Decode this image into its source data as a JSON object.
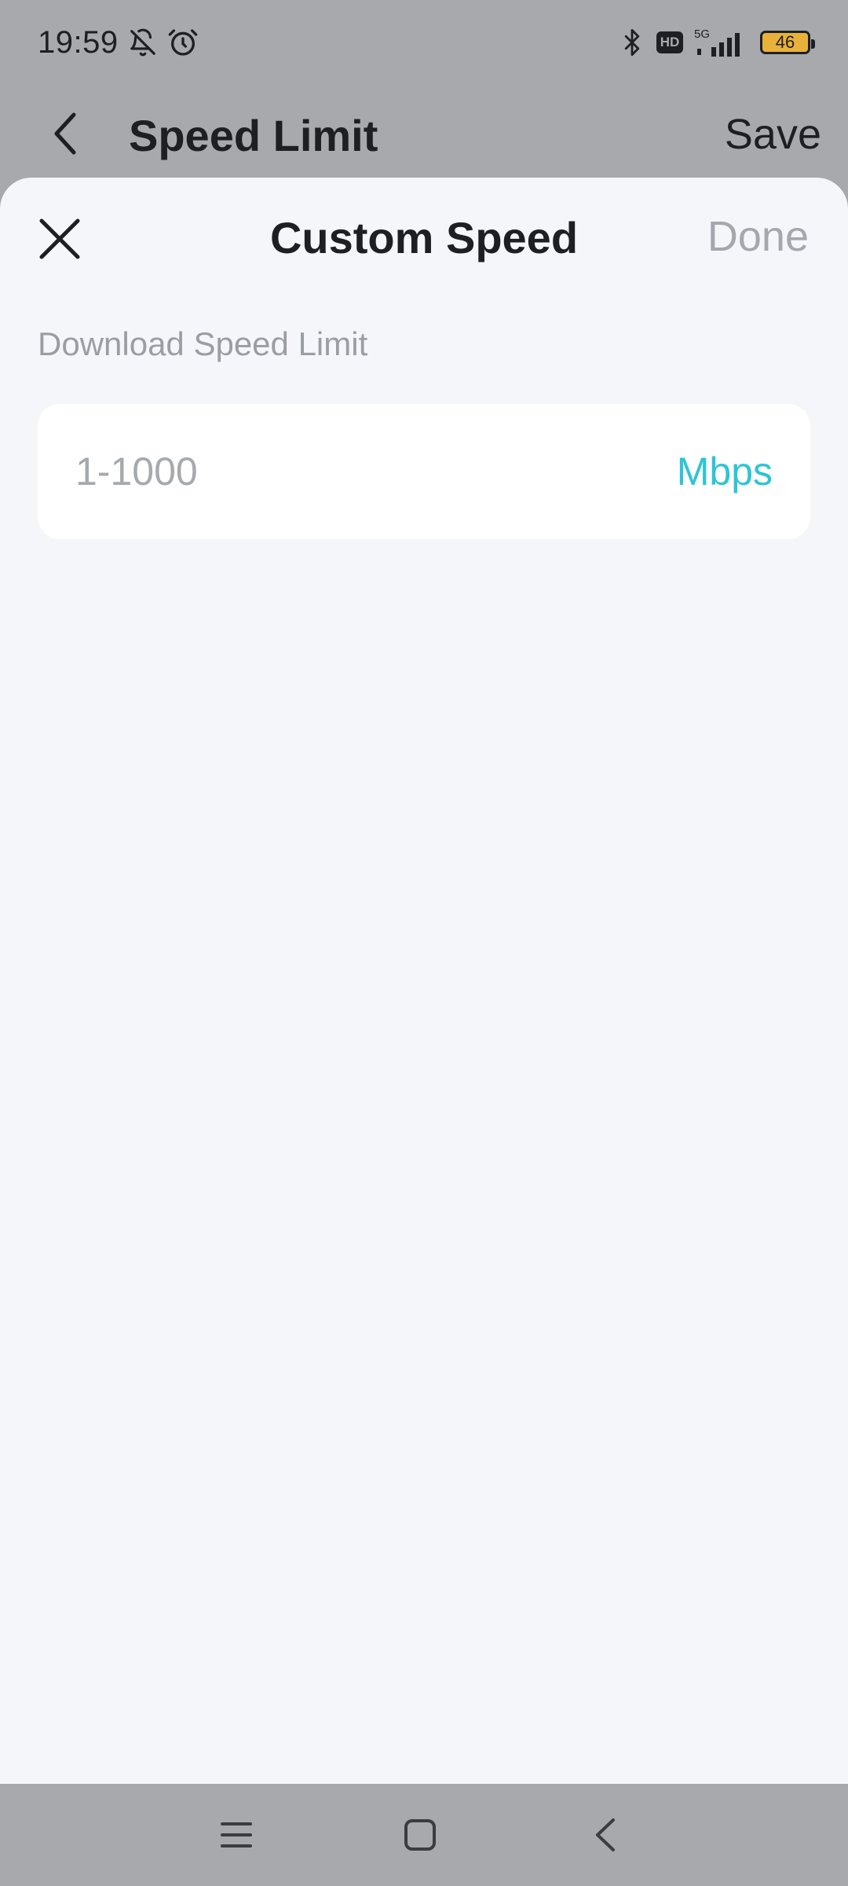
{
  "status_bar": {
    "time": "19:59",
    "icons": [
      "mute-bell-icon",
      "alarm-icon",
      "bluetooth-icon",
      "hd-icon",
      "5g-signal-icon",
      "battery-icon"
    ],
    "hd": "HD",
    "network": "5G",
    "battery": "46",
    "battery_color": "#e8b23a"
  },
  "header": {
    "title": "Speed Limit",
    "save_label": "Save",
    "back_icon": "chevron-left-icon"
  },
  "sheet": {
    "title": "Custom Speed",
    "done_label": "Done",
    "close_icon": "close-icon",
    "field_label": "Download Speed Limit",
    "input": {
      "value": "",
      "placeholder": "1-1000"
    },
    "unit": "Mbps",
    "accent_color": "#2ec4d6"
  },
  "nav_bar": {
    "icons": [
      "menu-icon",
      "home-icon",
      "back-icon"
    ]
  }
}
